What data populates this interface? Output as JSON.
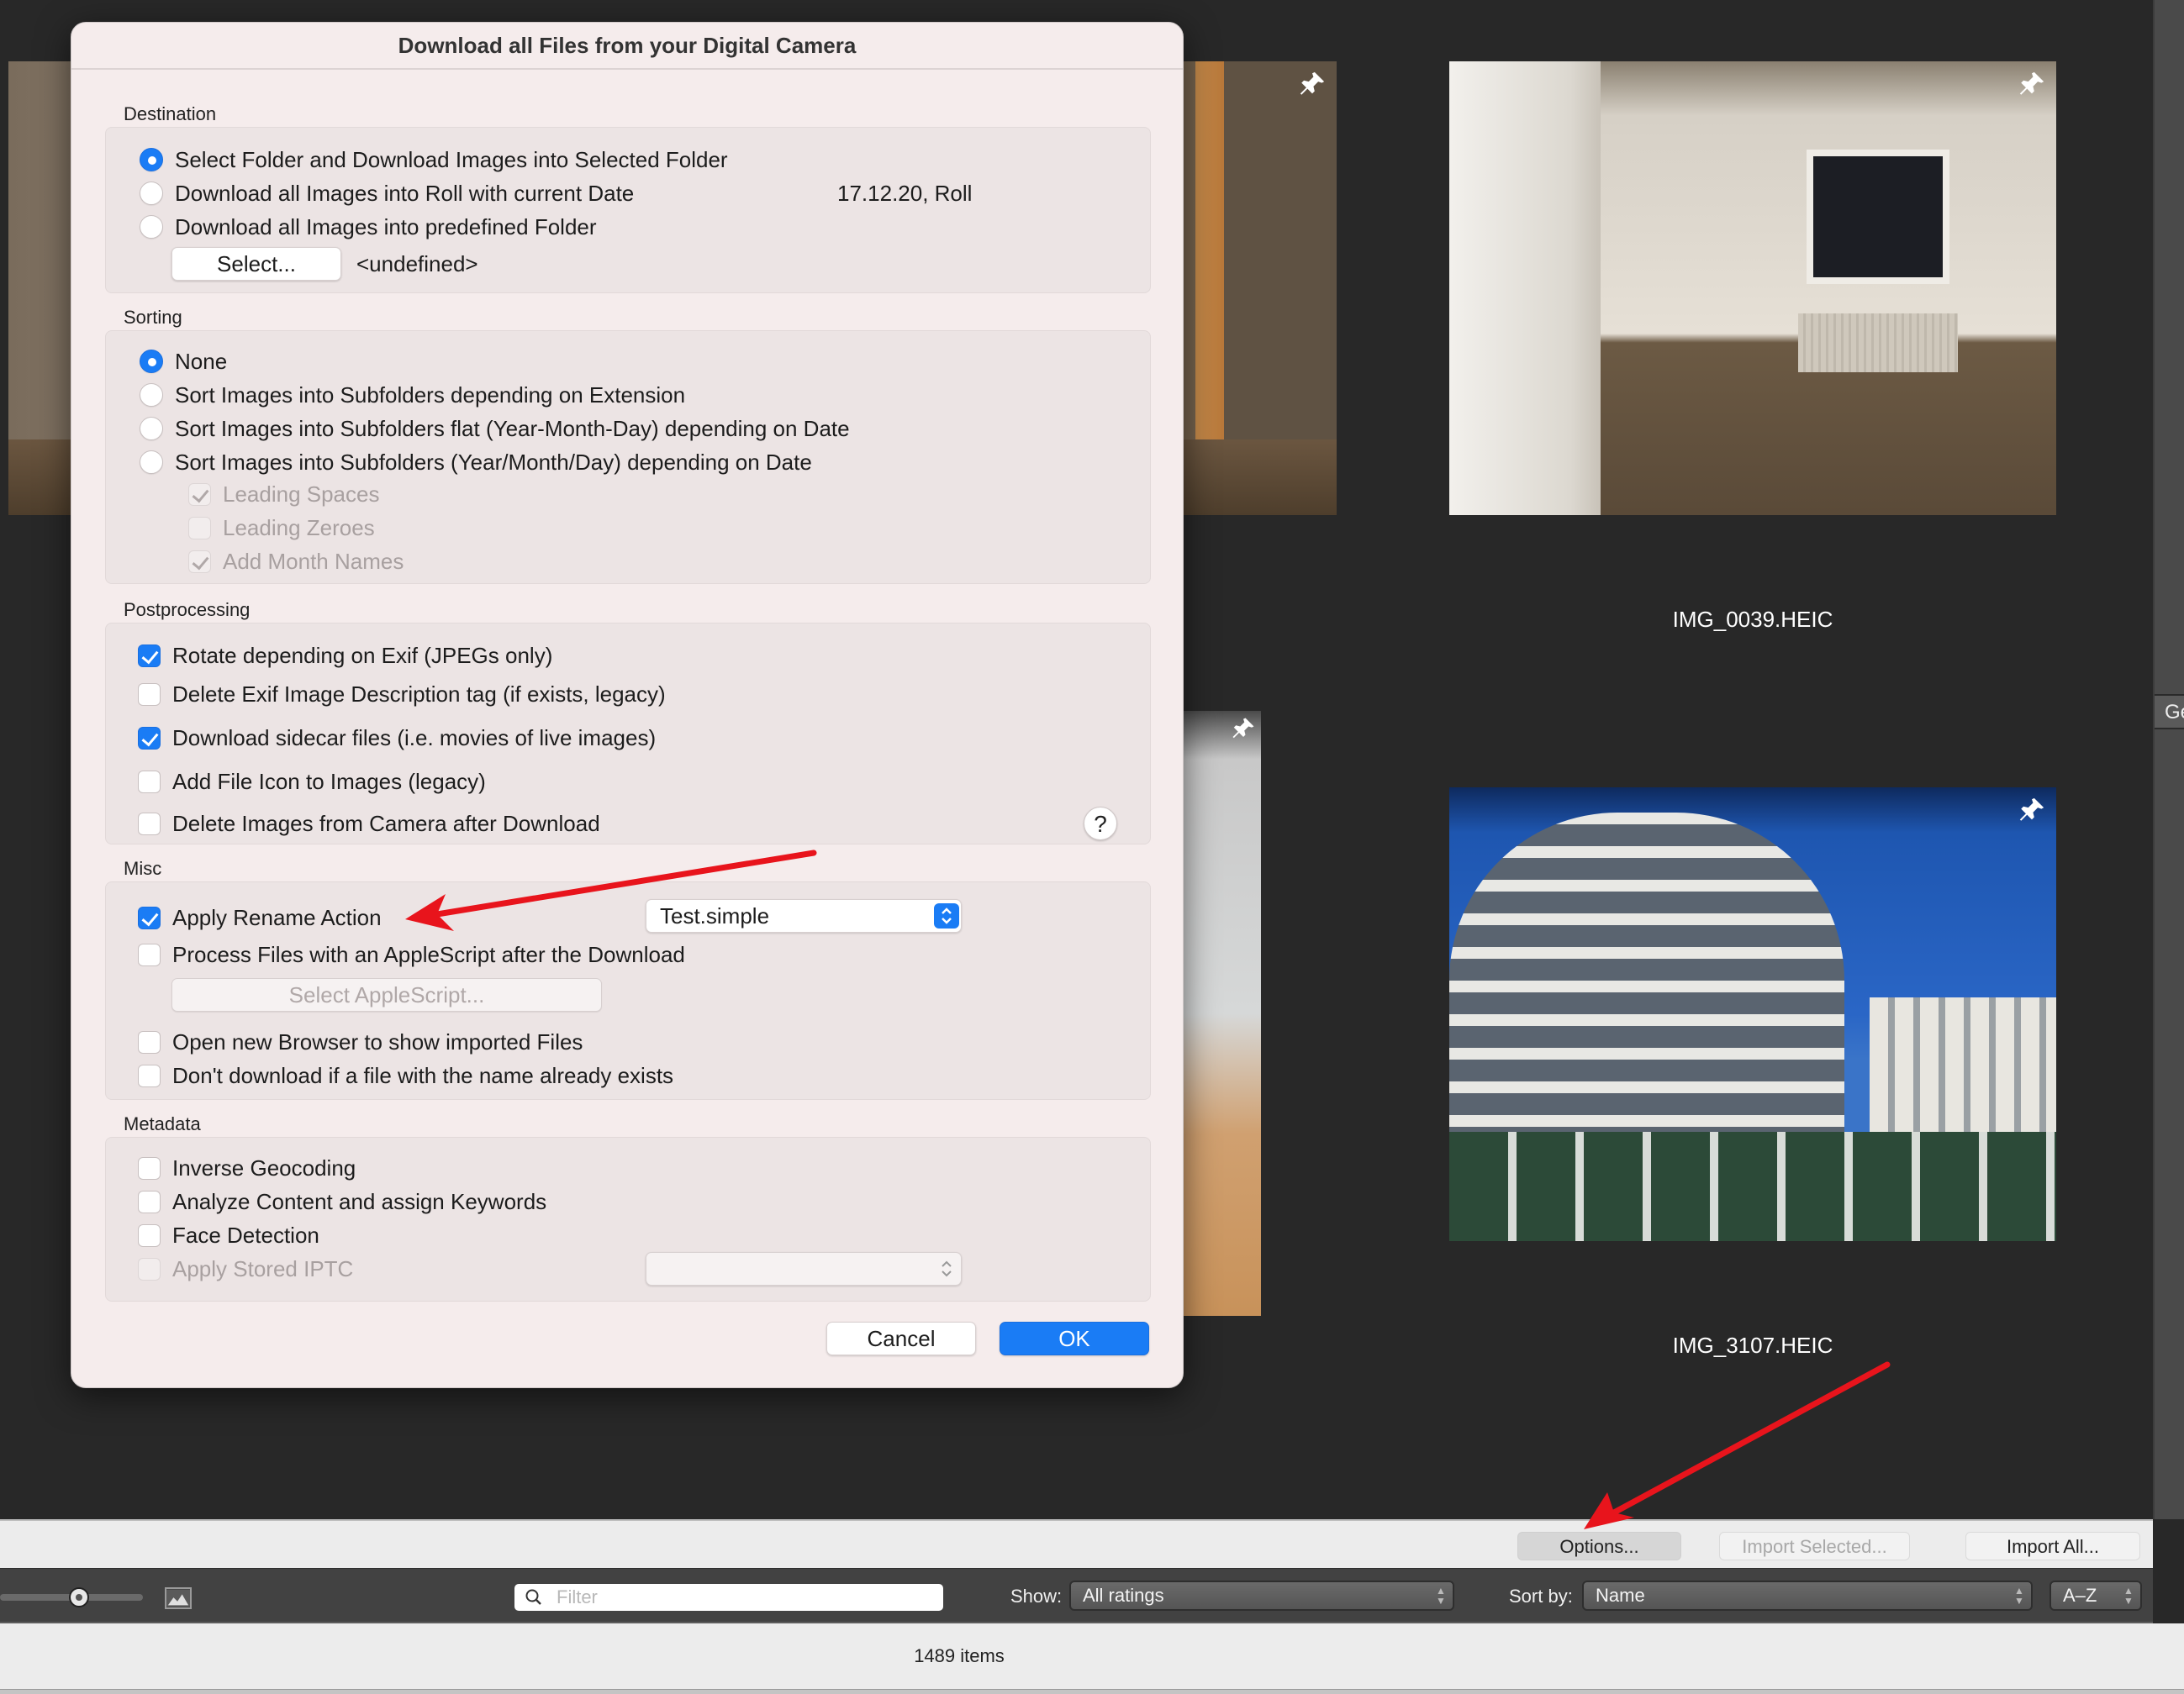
{
  "browser": {
    "thumbnails": [
      {
        "caption": ""
      },
      {
        "caption": "IMG_0039.HEIC"
      },
      {
        "caption": ""
      },
      {
        "caption": "IMG_3107.HEIC"
      }
    ],
    "right_panel_tab": "Ge",
    "import_bar": {
      "options": "Options...",
      "import_selected": "Import Selected...",
      "import_all": "Import All..."
    },
    "toolbar": {
      "filter_placeholder": "Filter",
      "filter_value": "",
      "show_label": "Show:",
      "show_value": "All ratings",
      "sort_label": "Sort by:",
      "sort_value": "Name",
      "order_value": "A–Z"
    },
    "status": {
      "item_count": "1489 items"
    }
  },
  "dialog": {
    "title": "Download all Files from your Digital Camera",
    "destination": {
      "label": "Destination",
      "options": [
        {
          "label": "Select Folder and Download Images into Selected Folder",
          "selected": true
        },
        {
          "label": "Download all Images into Roll with current Date",
          "selected": false
        },
        {
          "label": "Download all Images into predefined Folder",
          "selected": false
        }
      ],
      "roll_name": "17.12.20, Roll",
      "select_button": "Select...",
      "folder_value": "<undefined>"
    },
    "sorting": {
      "label": "Sorting",
      "options": [
        {
          "label": "None",
          "selected": true
        },
        {
          "label": "Sort Images into Subfolders depending on Extension",
          "selected": false
        },
        {
          "label": "Sort Images into Subfolders flat (Year-Month-Day) depending on Date",
          "selected": false
        },
        {
          "label": "Sort Images into Subfolders (Year/Month/Day) depending on Date",
          "selected": false
        }
      ],
      "sub_options": [
        {
          "label": "Leading Spaces",
          "checked": true,
          "enabled": false
        },
        {
          "label": "Leading Zeroes",
          "checked": false,
          "enabled": false
        },
        {
          "label": "Add Month Names",
          "checked": true,
          "enabled": false
        }
      ]
    },
    "postprocessing": {
      "label": "Postprocessing",
      "options": [
        {
          "label": "Rotate depending on Exif (JPEGs only)",
          "checked": true
        },
        {
          "label": "Delete Exif Image Description tag (if exists, legacy)",
          "checked": false
        },
        {
          "label": "Download sidecar files (i.e. movies of live images)",
          "checked": true
        },
        {
          "label": "Add File Icon to Images (legacy)",
          "checked": false
        },
        {
          "label": "Delete Images from Camera after Download",
          "checked": false
        }
      ],
      "help": "?"
    },
    "misc": {
      "label": "Misc",
      "options": [
        {
          "label": "Apply Rename Action",
          "checked": true
        },
        {
          "label": "Process Files with an AppleScript after the Download",
          "checked": false
        },
        {
          "label": "Open new Browser to show imported Files",
          "checked": false
        },
        {
          "label": "Don't download if a file with the name already exists",
          "checked": false
        }
      ],
      "rename_action_value": "Test.simple",
      "select_applescript_button": "Select AppleScript..."
    },
    "metadata": {
      "label": "Metadata",
      "options": [
        {
          "label": "Inverse Geocoding",
          "checked": false,
          "enabled": true
        },
        {
          "label": "Analyze Content and assign Keywords",
          "checked": false,
          "enabled": true
        },
        {
          "label": "Face Detection",
          "checked": false,
          "enabled": true
        },
        {
          "label": "Apply Stored IPTC",
          "checked": false,
          "enabled": false
        }
      ],
      "iptc_value": ""
    },
    "buttons": {
      "cancel": "Cancel",
      "ok": "OK"
    }
  },
  "colors": {
    "accent": "#1a7cf5",
    "annotation_arrow": "#e8141c",
    "dialog_bg": "#f5ecec",
    "browser_bg": "#282828"
  }
}
